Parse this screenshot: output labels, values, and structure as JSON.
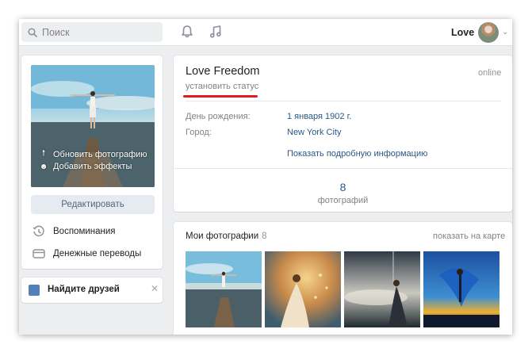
{
  "header": {
    "search_placeholder": "Поиск",
    "user_name": "Love"
  },
  "left": {
    "photo_actions": {
      "update_photo": "Обновить фотографию",
      "add_effects": "Добавить эффекты"
    },
    "edit_label": "Редактировать",
    "links": {
      "memories": "Воспоминания",
      "money_transfers": "Денежные переводы"
    },
    "find_friends": "Найдите друзей"
  },
  "profile": {
    "name": "Love Freedom",
    "status_placeholder": "установить статус",
    "online": "online",
    "birthday_label": "День рождения:",
    "birthday_value": "1 января 1902 г.",
    "city_label": "Город:",
    "city_value": "New York City",
    "more_info": "Показать подробную информацию",
    "photos_count": "8",
    "photos_count_label": "фотографий"
  },
  "photos": {
    "title": "Мои фотографии",
    "count": "8",
    "map_link": "показать на карте"
  },
  "colors": {
    "link_blue": "#2a5885",
    "accent_blue": "#5181b8",
    "status_underline": "#e01d1d",
    "background": "#edeef0"
  },
  "icons": {
    "search": "search-icon",
    "bell": "bell-icon",
    "music": "music-note-icon",
    "memories": "clock-history-icon",
    "money": "card-transfer-icon",
    "add_friend": "add-user-icon",
    "close": "close-icon"
  }
}
